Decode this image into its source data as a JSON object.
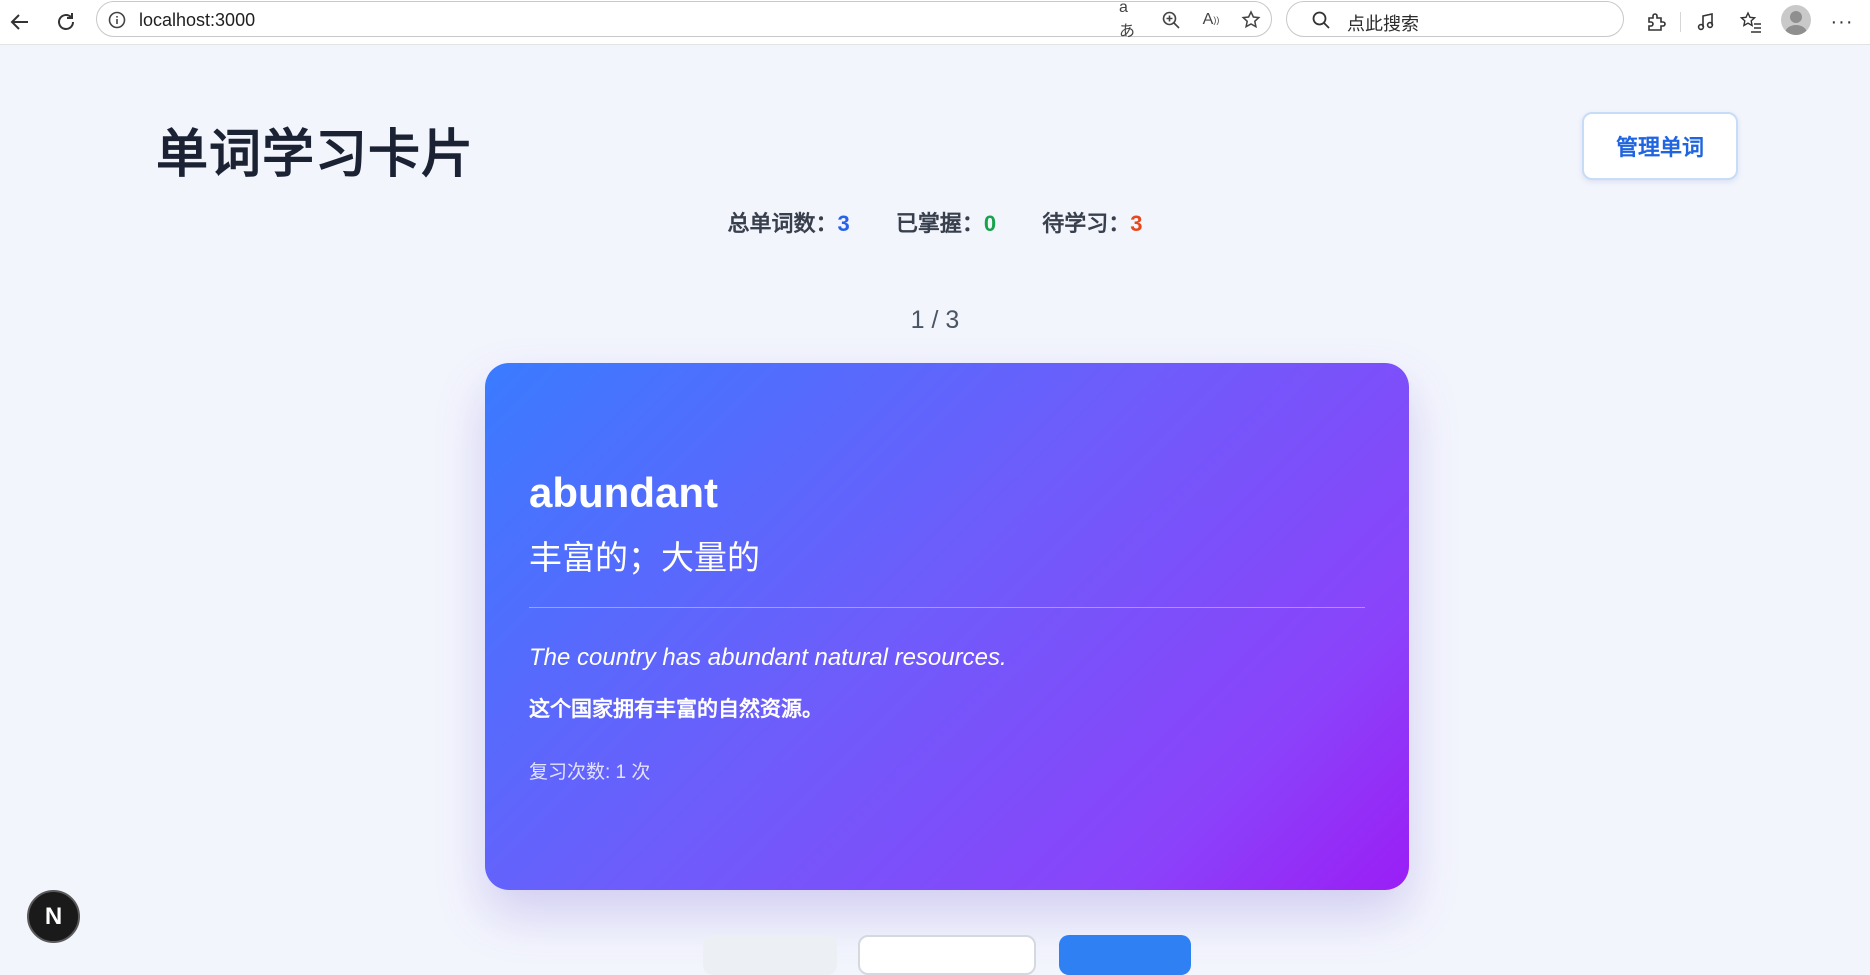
{
  "browser": {
    "url": "localhost:3000",
    "search_placeholder": "点此搜索"
  },
  "page": {
    "title": "单词学习卡片",
    "manage_button": "管理单词"
  },
  "stats": {
    "total_label": "总单词数：",
    "total_value": "3",
    "mastered_label": "已掌握：",
    "mastered_value": "0",
    "pending_label": "待学习：",
    "pending_value": "3"
  },
  "progress": "1 / 3",
  "card": {
    "word": "abundant",
    "meaning": "丰富的；大量的",
    "example": "The country has abundant natural resources.",
    "example_translation": "这个国家拥有丰富的自然资源。",
    "review_count": "复习次数: 1 次"
  },
  "dev_badge": "N",
  "colors": {
    "accent_blue": "#2563eb",
    "mastered_green": "#16a34a",
    "pending_orange": "#e8471c",
    "card_gradient_start": "#3a7bff",
    "card_gradient_end": "#9b1ef5"
  }
}
